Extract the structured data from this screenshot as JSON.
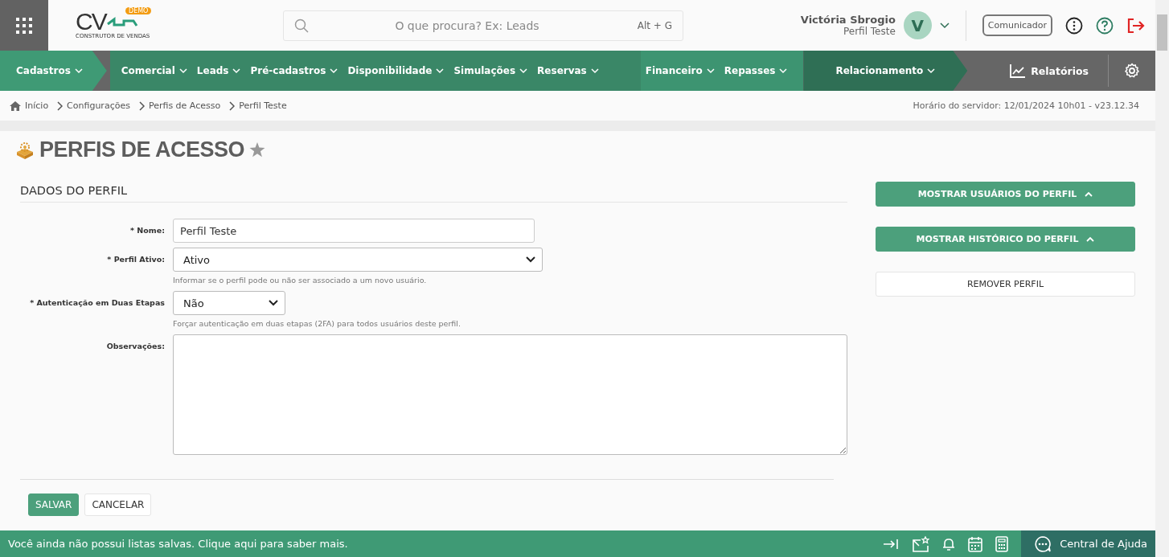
{
  "header": {
    "logo_badge": "DEMO",
    "logo_text": "CV",
    "logo_tagline": "CONSTRUTOR DE VENDAS",
    "search": {
      "placeholder": "O que procura? Ex: Leads",
      "shortcut": "Alt + G"
    },
    "user": {
      "name": "Victória Sbrogio",
      "profile": "Perfil Teste",
      "initial": "V"
    },
    "communicator_button": "Comunicador"
  },
  "nav": {
    "items": [
      {
        "label": "Cadastros",
        "color": "#3f9a75"
      },
      {
        "label": "Comercial",
        "color": "#3a8767"
      },
      {
        "label": "Leads",
        "color": "#3a8767"
      },
      {
        "label": "Pré-cadastros",
        "color": "#3a8767"
      },
      {
        "label": "Disponibilidade",
        "color": "#3a8767"
      },
      {
        "label": "Simulações",
        "color": "#3a8767"
      },
      {
        "label": "Reservas",
        "color": "#3a8767"
      },
      {
        "label": "Financeiro",
        "color": "#3d9471"
      },
      {
        "label": "Repasses",
        "color": "#3d9471"
      },
      {
        "label": "Relacionamento",
        "color": "#2f6f55"
      }
    ],
    "reports": "Relatórios"
  },
  "breadcrumb": [
    "Início",
    "Configurações",
    "Perfis de Acesso",
    "Perfil Teste"
  ],
  "server_time": "Horário do servidor: 12/01/2024 10h01 - v23.12.34",
  "page_title": "PERFIS DE ACESSO",
  "section_title": "DADOS DO PERFIL",
  "form": [
    {
      "kind": "input",
      "label": "* Nome:",
      "value": "Perfil Teste"
    },
    {
      "kind": "select",
      "label": "* Perfil Ativo:",
      "value": "Ativo",
      "help": "Informar se o perfil pode ou não ser associado a um novo usuário."
    },
    {
      "kind": "select",
      "label": "* Autenticação em Duas Etapas",
      "value": "Não",
      "help": "Forçar autenticação em duas etapas (2FA) para todos usuários deste perfil."
    },
    {
      "kind": "textarea",
      "label": "Observações:"
    }
  ],
  "actions": [
    {
      "label": "SALVAR",
      "primary": true
    },
    {
      "label": "CANCELAR",
      "primary": false
    }
  ],
  "side_buttons": [
    {
      "label": "MOSTRAR USUÁRIOS DO PERFIL",
      "primary": true,
      "expanded": true
    },
    {
      "label": "MOSTRAR HISTÓRICO DO PERFIL",
      "primary": true,
      "expanded": true
    },
    {
      "label": "REMOVER PERFIL",
      "primary": false,
      "expanded": false
    }
  ],
  "footer": {
    "message": "Você ainda não possui listas salvas. Clique aqui para saber mais.",
    "help": "Central de Ajuda"
  }
}
